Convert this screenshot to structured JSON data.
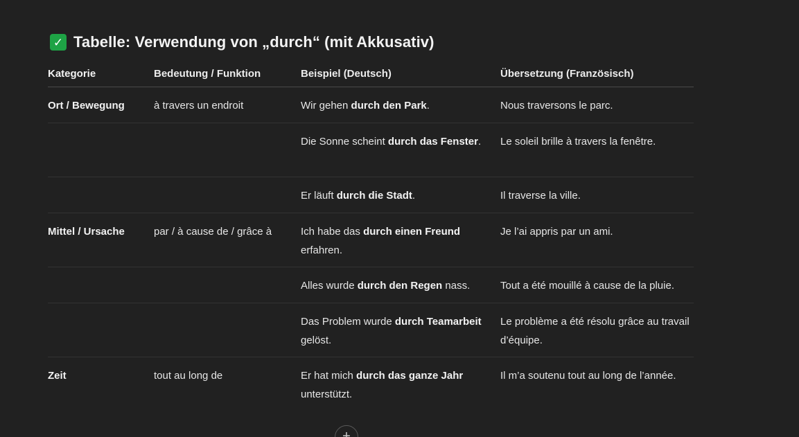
{
  "heading": {
    "icon": "check-mark-icon",
    "icon_glyph": "✓",
    "title": "Tabelle: Verwendung von „durch“ (mit Akkusativ)"
  },
  "table": {
    "headers": [
      "Kategorie",
      "Bedeutung / Funktion",
      "Beispiel (Deutsch)",
      "Übersetzung (Französisch)"
    ],
    "rows": [
      {
        "category": "Ort / Bewegung",
        "meaning": "à travers un endroit",
        "example": [
          {
            "t": "Wir gehen "
          },
          {
            "t": "durch den Park",
            "b": true
          },
          {
            "t": "."
          }
        ],
        "translation": "Nous traversons le parc."
      },
      {
        "category": "",
        "meaning": "",
        "example": [
          {
            "t": "Die Sonne scheint "
          },
          {
            "t": "durch das Fenster",
            "b": true
          },
          {
            "t": "."
          }
        ],
        "translation": "Le soleil brille à travers la fenêtre."
      },
      {
        "category": "",
        "meaning": "",
        "example": [
          {
            "t": "Er läuft "
          },
          {
            "t": "durch die Stadt",
            "b": true
          },
          {
            "t": "."
          }
        ],
        "translation": "Il traverse la ville."
      },
      {
        "category": "Mittel / Ursache",
        "meaning": "par / à cause de / grâce à",
        "example": [
          {
            "t": "Ich habe das "
          },
          {
            "t": "durch einen Freund",
            "b": true
          },
          {
            "t": " erfahren."
          }
        ],
        "translation": "Je l’ai appris par un ami."
      },
      {
        "category": "",
        "meaning": "",
        "example": [
          {
            "t": "Alles wurde "
          },
          {
            "t": "durch den Regen",
            "b": true
          },
          {
            "t": " nass."
          }
        ],
        "translation": "Tout a été mouillé à cause de la pluie."
      },
      {
        "category": "",
        "meaning": "",
        "example": [
          {
            "t": "Das Problem wurde "
          },
          {
            "t": "durch Teamarbeit",
            "b": true
          },
          {
            "t": " gelöst."
          }
        ],
        "translation": "Le problème a été résolu grâce au travail d’équipe."
      },
      {
        "category": "Zeit",
        "meaning": "tout au long de",
        "example": [
          {
            "t": "Er hat mich "
          },
          {
            "t": "durch das ganze Jahr",
            "b": true
          },
          {
            "t": " unterstützt."
          }
        ],
        "translation": "Il m’a soutenu tout au long de l’année."
      }
    ]
  },
  "add_button": {
    "icon": "plus-icon",
    "glyph": "+"
  },
  "colors": {
    "background": "#212121",
    "text": "#ececec",
    "check_green": "#1ea345",
    "divider": "#333333"
  }
}
